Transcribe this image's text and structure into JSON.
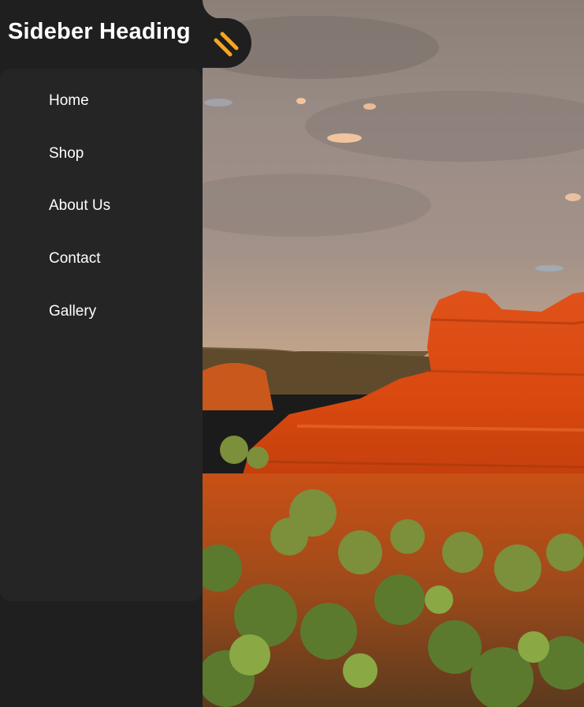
{
  "sidebar": {
    "heading": "Sideber Heading",
    "toggle_icon": "pencil-stripes-icon",
    "accent_color": "#f5a623",
    "items": [
      {
        "label": "Home"
      },
      {
        "label": "Shop"
      },
      {
        "label": "About Us"
      },
      {
        "label": "Contact"
      },
      {
        "label": "Gallery"
      }
    ]
  },
  "hero": {
    "image": "desert-canyon-sunset-photo"
  }
}
